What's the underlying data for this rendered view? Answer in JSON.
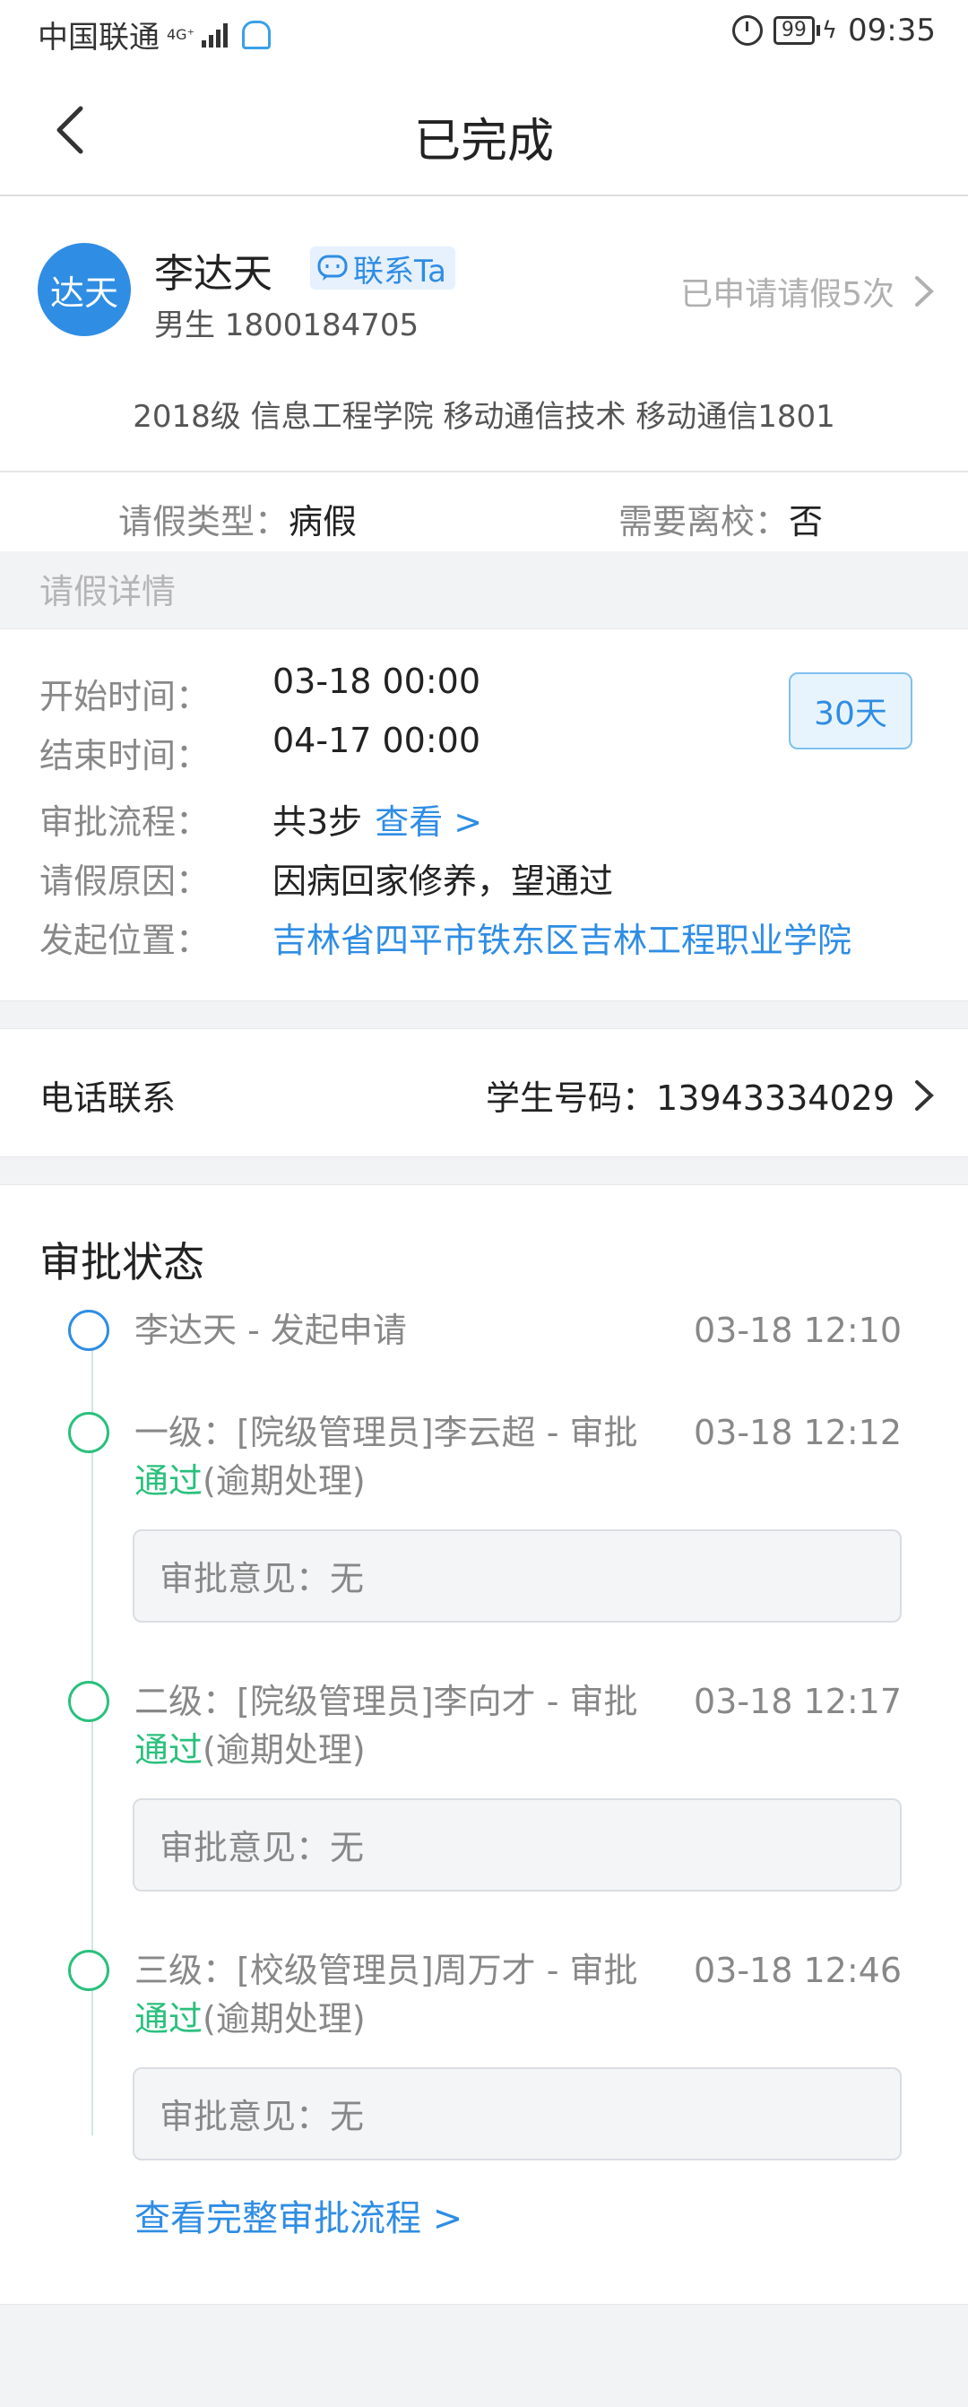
{
  "status_bar": {
    "carrier": "中国联通",
    "network": "4G⁺",
    "battery": "99",
    "time": "09:35"
  },
  "nav": {
    "title": "已完成"
  },
  "student": {
    "avatar_text": "达天",
    "name": "李达天",
    "contact_label": "联系Ta",
    "gender_id": "男生  1800184705",
    "leave_count": "已申请请假5次",
    "class_info": "2018级 信息工程学院 移动通信技术 移动通信1801"
  },
  "leave_type": {
    "type_label": "请假类型：",
    "type_value": "病假",
    "leave_school_label": "需要离校：",
    "leave_school_value": "否"
  },
  "details_header": "请假详情",
  "details": {
    "start_label": "开始时间：",
    "start_value": "03-18 00:00",
    "end_label": "结束时间：",
    "end_value": "04-17 00:00",
    "flow_label": "审批流程：",
    "flow_value": "共3步",
    "flow_link": "查看 >",
    "reason_label": "请假原因：",
    "reason_value": "因病回家修养，望通过",
    "location_label": "发起位置：",
    "location_value": "吉林省四平市铁东区吉林工程职业学院",
    "days_badge": "30天"
  },
  "phone": {
    "label": "电话联系",
    "student_number": "学生号码：13943334029"
  },
  "approval": {
    "title": "审批状态",
    "steps": [
      {
        "text": "李达天 - 发起申请",
        "time": "03-18 12:10"
      },
      {
        "text": "一级：[院级管理员]李云超 - 审批",
        "time": "03-18 12:12",
        "result": "通过",
        "note": "(逾期处理)",
        "opinion": "审批意见：无"
      },
      {
        "text": "二级：[院级管理员]李向才 - 审批",
        "time": "03-18 12:17",
        "result": "通过",
        "note": "(逾期处理)",
        "opinion": "审批意见：无"
      },
      {
        "text": "三级：[校级管理员]周万才 - 审批",
        "time": "03-18 12:46",
        "result": "通过",
        "note": "(逾期处理)",
        "opinion": "审批意见：无"
      }
    ],
    "full_flow_link": "查看完整审批流程 >"
  },
  "colors": {
    "accent_blue": "#2f8de4",
    "pass_green": "#2ac07c",
    "background": "#f2f3f5"
  }
}
